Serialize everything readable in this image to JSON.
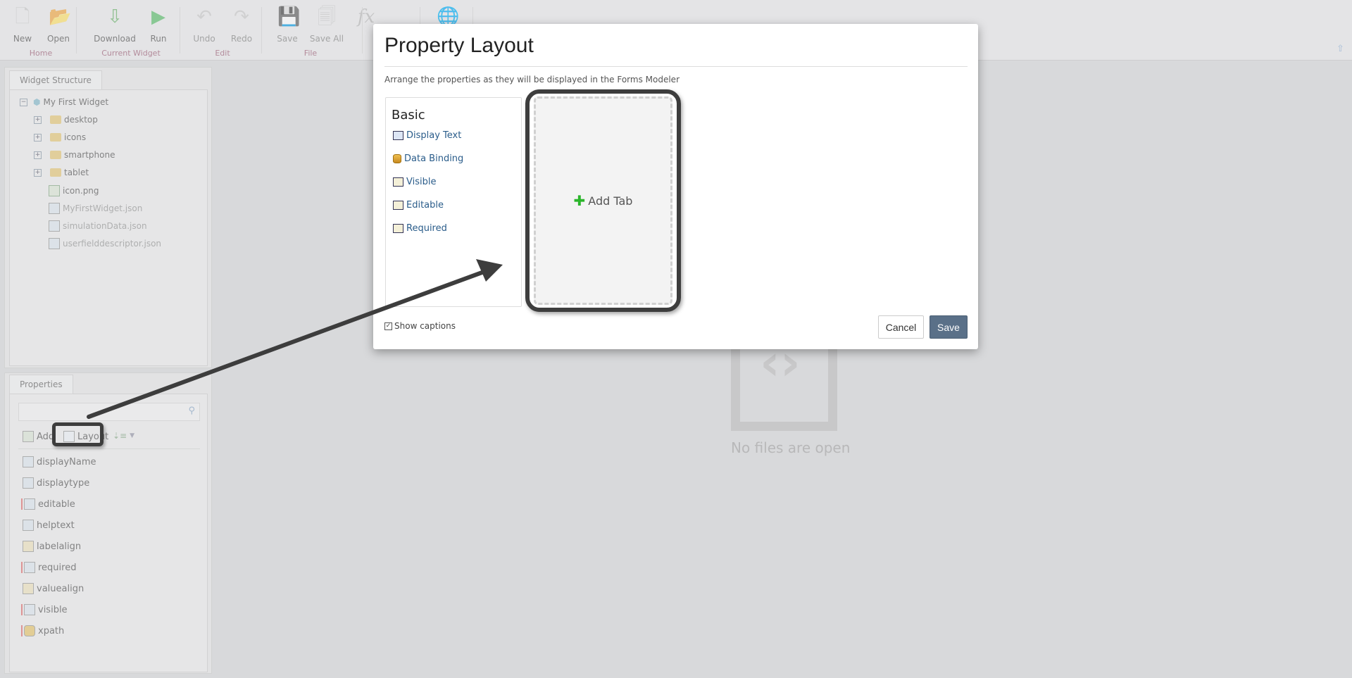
{
  "toolbar": {
    "buttons": [
      {
        "label": "New",
        "icon": "new-file-icon"
      },
      {
        "label": "Open",
        "icon": "open-folder-icon"
      },
      {
        "label": "Download",
        "icon": "download-icon"
      },
      {
        "label": "Run",
        "icon": "play-icon"
      },
      {
        "label": "Undo",
        "icon": "undo-icon"
      },
      {
        "label": "Redo",
        "icon": "redo-icon"
      },
      {
        "label": "Save",
        "icon": "floppy-icon"
      },
      {
        "label": "Save All",
        "icon": "floppy-multiple-icon"
      }
    ],
    "groups": [
      "Home",
      "Current Widget",
      "Edit",
      "File"
    ],
    "extra_icons": [
      "function-icon",
      "globe-icon"
    ]
  },
  "widget_structure": {
    "tab": "Widget Structure",
    "root": "My First Widget",
    "folders": [
      "desktop",
      "icons",
      "smartphone",
      "tablet"
    ],
    "files": [
      "icon.png",
      "MyFirstWidget.json",
      "simulationData.json",
      "userfielddescriptor.json"
    ]
  },
  "properties": {
    "tab": "Properties",
    "search_placeholder": "",
    "add_label": "Add",
    "layout_label": "Layout",
    "items": [
      "displayName",
      "displaytype",
      "editable",
      "helptext",
      "labelalign",
      "required",
      "valuealign",
      "visible",
      "xpath"
    ]
  },
  "main": {
    "empty_text": "No files are open"
  },
  "dialog": {
    "title": "Property Layout",
    "description": "Arrange the properties as they will be displayed in the Forms Modeler",
    "group_title": "Basic",
    "items": [
      "Display Text",
      "Data Binding",
      "Visible",
      "Editable",
      "Required"
    ],
    "add_tab": "Add Tab",
    "show_captions": "Show captions",
    "show_captions_checked": true,
    "cancel": "Cancel",
    "save": "Save"
  },
  "colors": {
    "save_button": "#5a7088",
    "annotation": "#3d3d3d",
    "add_icon": "#2bb52b"
  }
}
